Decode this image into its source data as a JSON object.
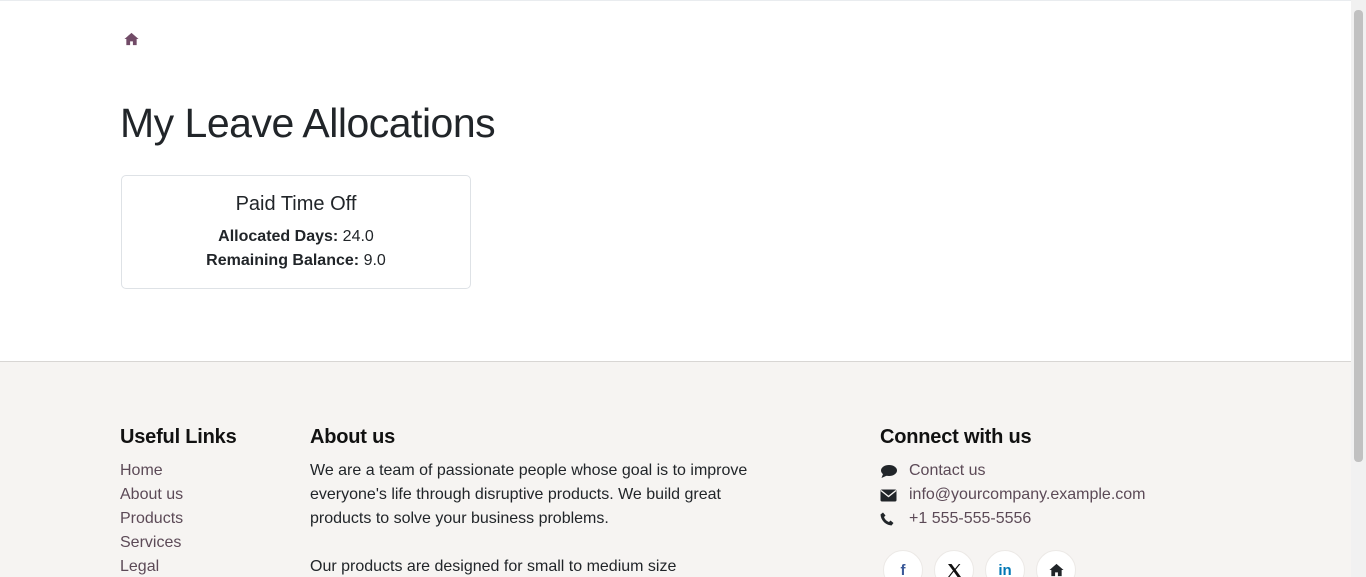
{
  "breadcrumb": {
    "home_icon": "home-icon"
  },
  "page": {
    "title": "My Leave Allocations"
  },
  "allocation": {
    "title": "Paid Time Off",
    "allocated_label": "Allocated Days:",
    "allocated_value": "24.0",
    "remaining_label": "Remaining Balance:",
    "remaining_value": "9.0"
  },
  "footer": {
    "useful_links": {
      "title": "Useful Links",
      "items": [
        "Home",
        "About us",
        "Products",
        "Services",
        "Legal"
      ]
    },
    "about": {
      "title": "About us",
      "para1": "We are a team of passionate people whose goal is to improve everyone's life through disruptive products. We build great products to solve your business problems.",
      "para2": "Our products are designed for small to medium size"
    },
    "connect": {
      "title": "Connect with us",
      "contact": "Contact us",
      "email": "info@yourcompany.example.com",
      "phone": "+1 555-555-5556",
      "social": {
        "facebook": "f",
        "linkedin": "in"
      }
    }
  },
  "colors": {
    "link": "#5c4a57",
    "footer_bg": "#f6f4f2",
    "brand_icon": "#714b67",
    "facebook": "#3b5998",
    "linkedin": "#0077b5"
  }
}
